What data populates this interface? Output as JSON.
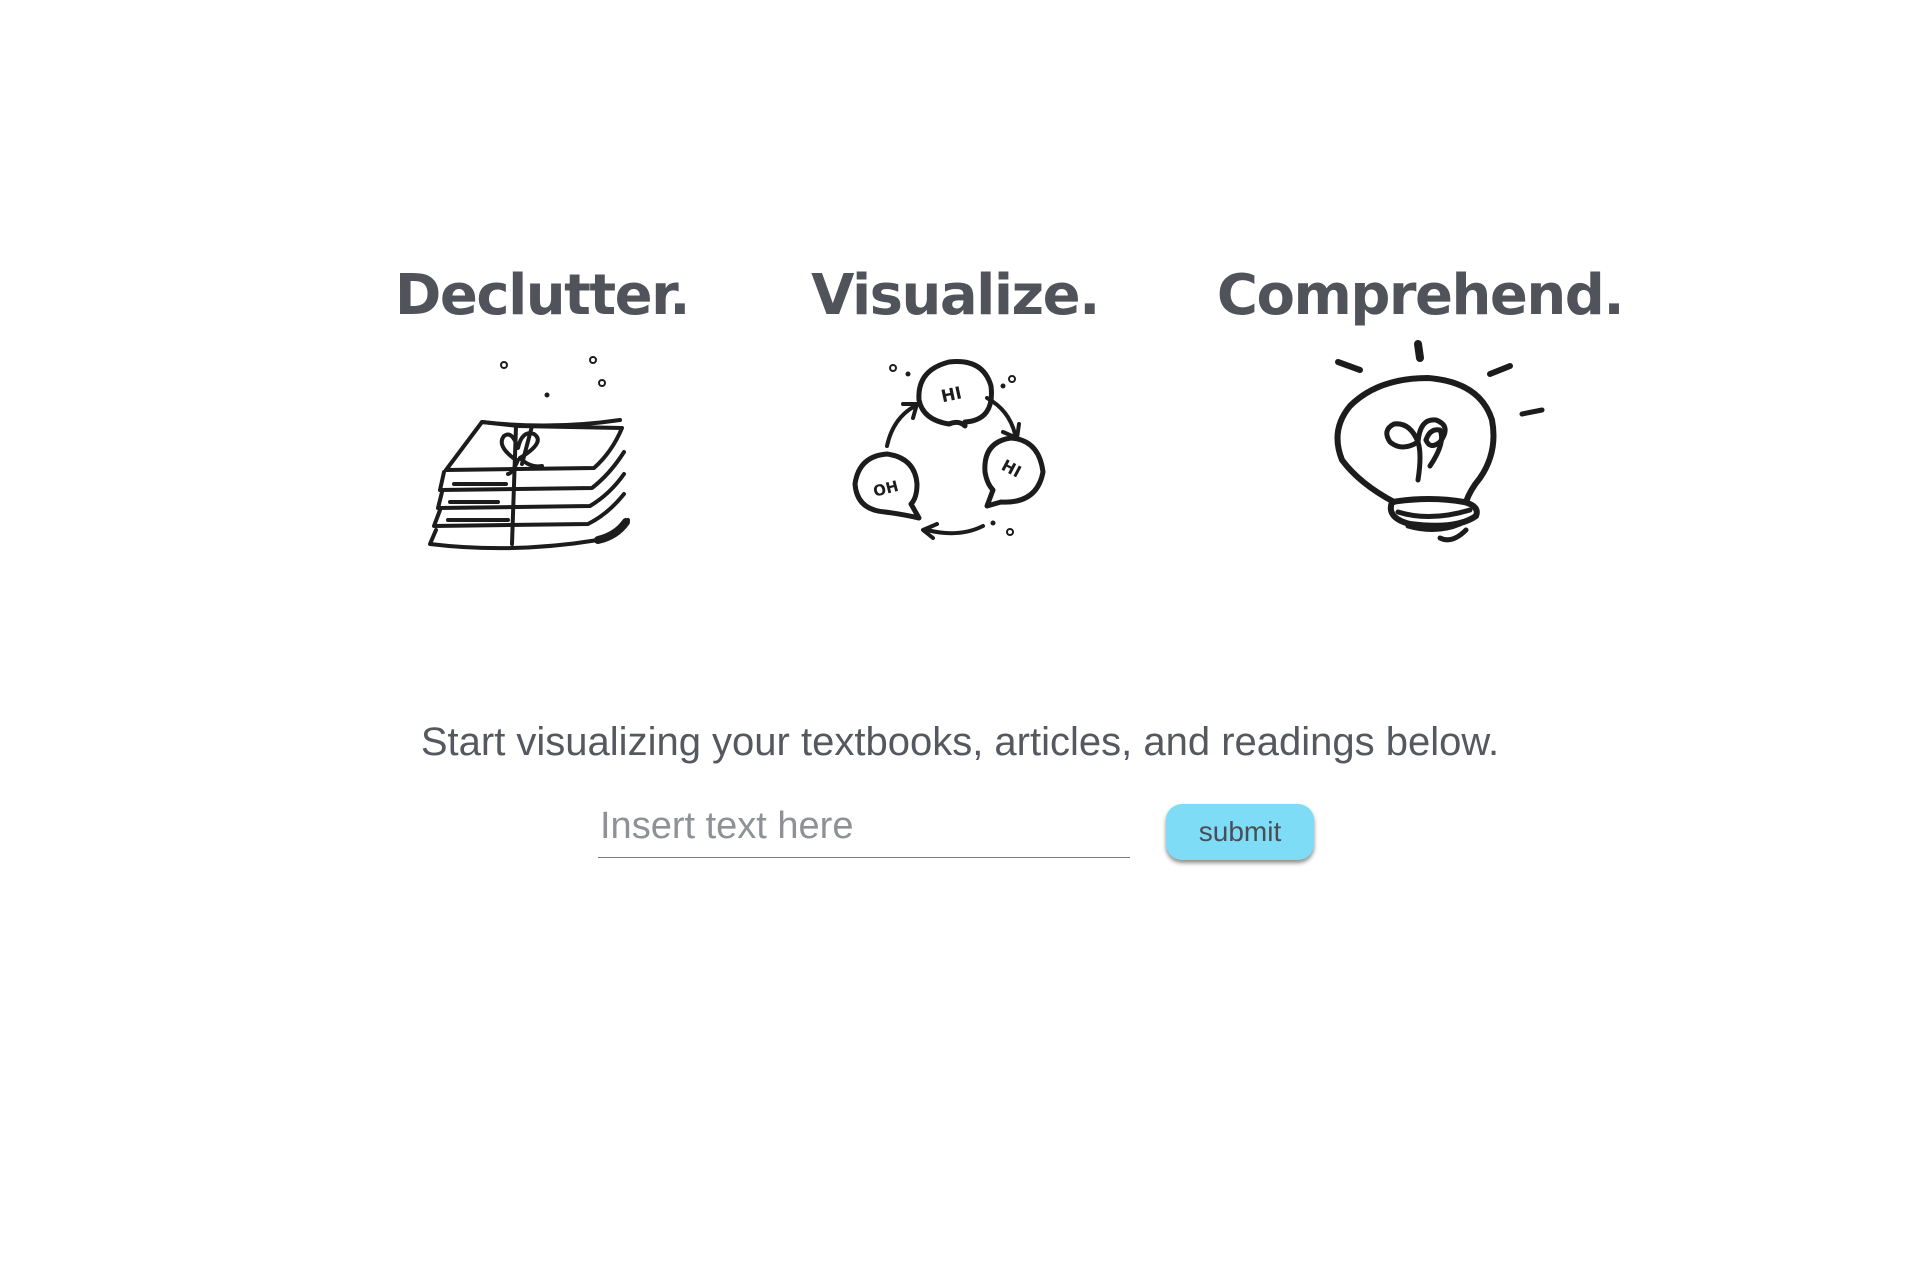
{
  "features": [
    {
      "title": "Declutter.",
      "icon": "paper-stack-icon"
    },
    {
      "title": "Visualize.",
      "icon": "chat-cycle-icon",
      "bubbles": [
        "HI",
        "HI",
        "OH"
      ]
    },
    {
      "title": "Comprehend.",
      "icon": "lightbulb-icon"
    }
  ],
  "tagline": "Start visualizing your textbooks, articles, and readings below.",
  "form": {
    "input_placeholder": "Insert text here",
    "input_value": "",
    "submit_label": "submit"
  },
  "colors": {
    "text": "#50545a",
    "button": "#7fdcf6",
    "background": "#ffffff"
  }
}
